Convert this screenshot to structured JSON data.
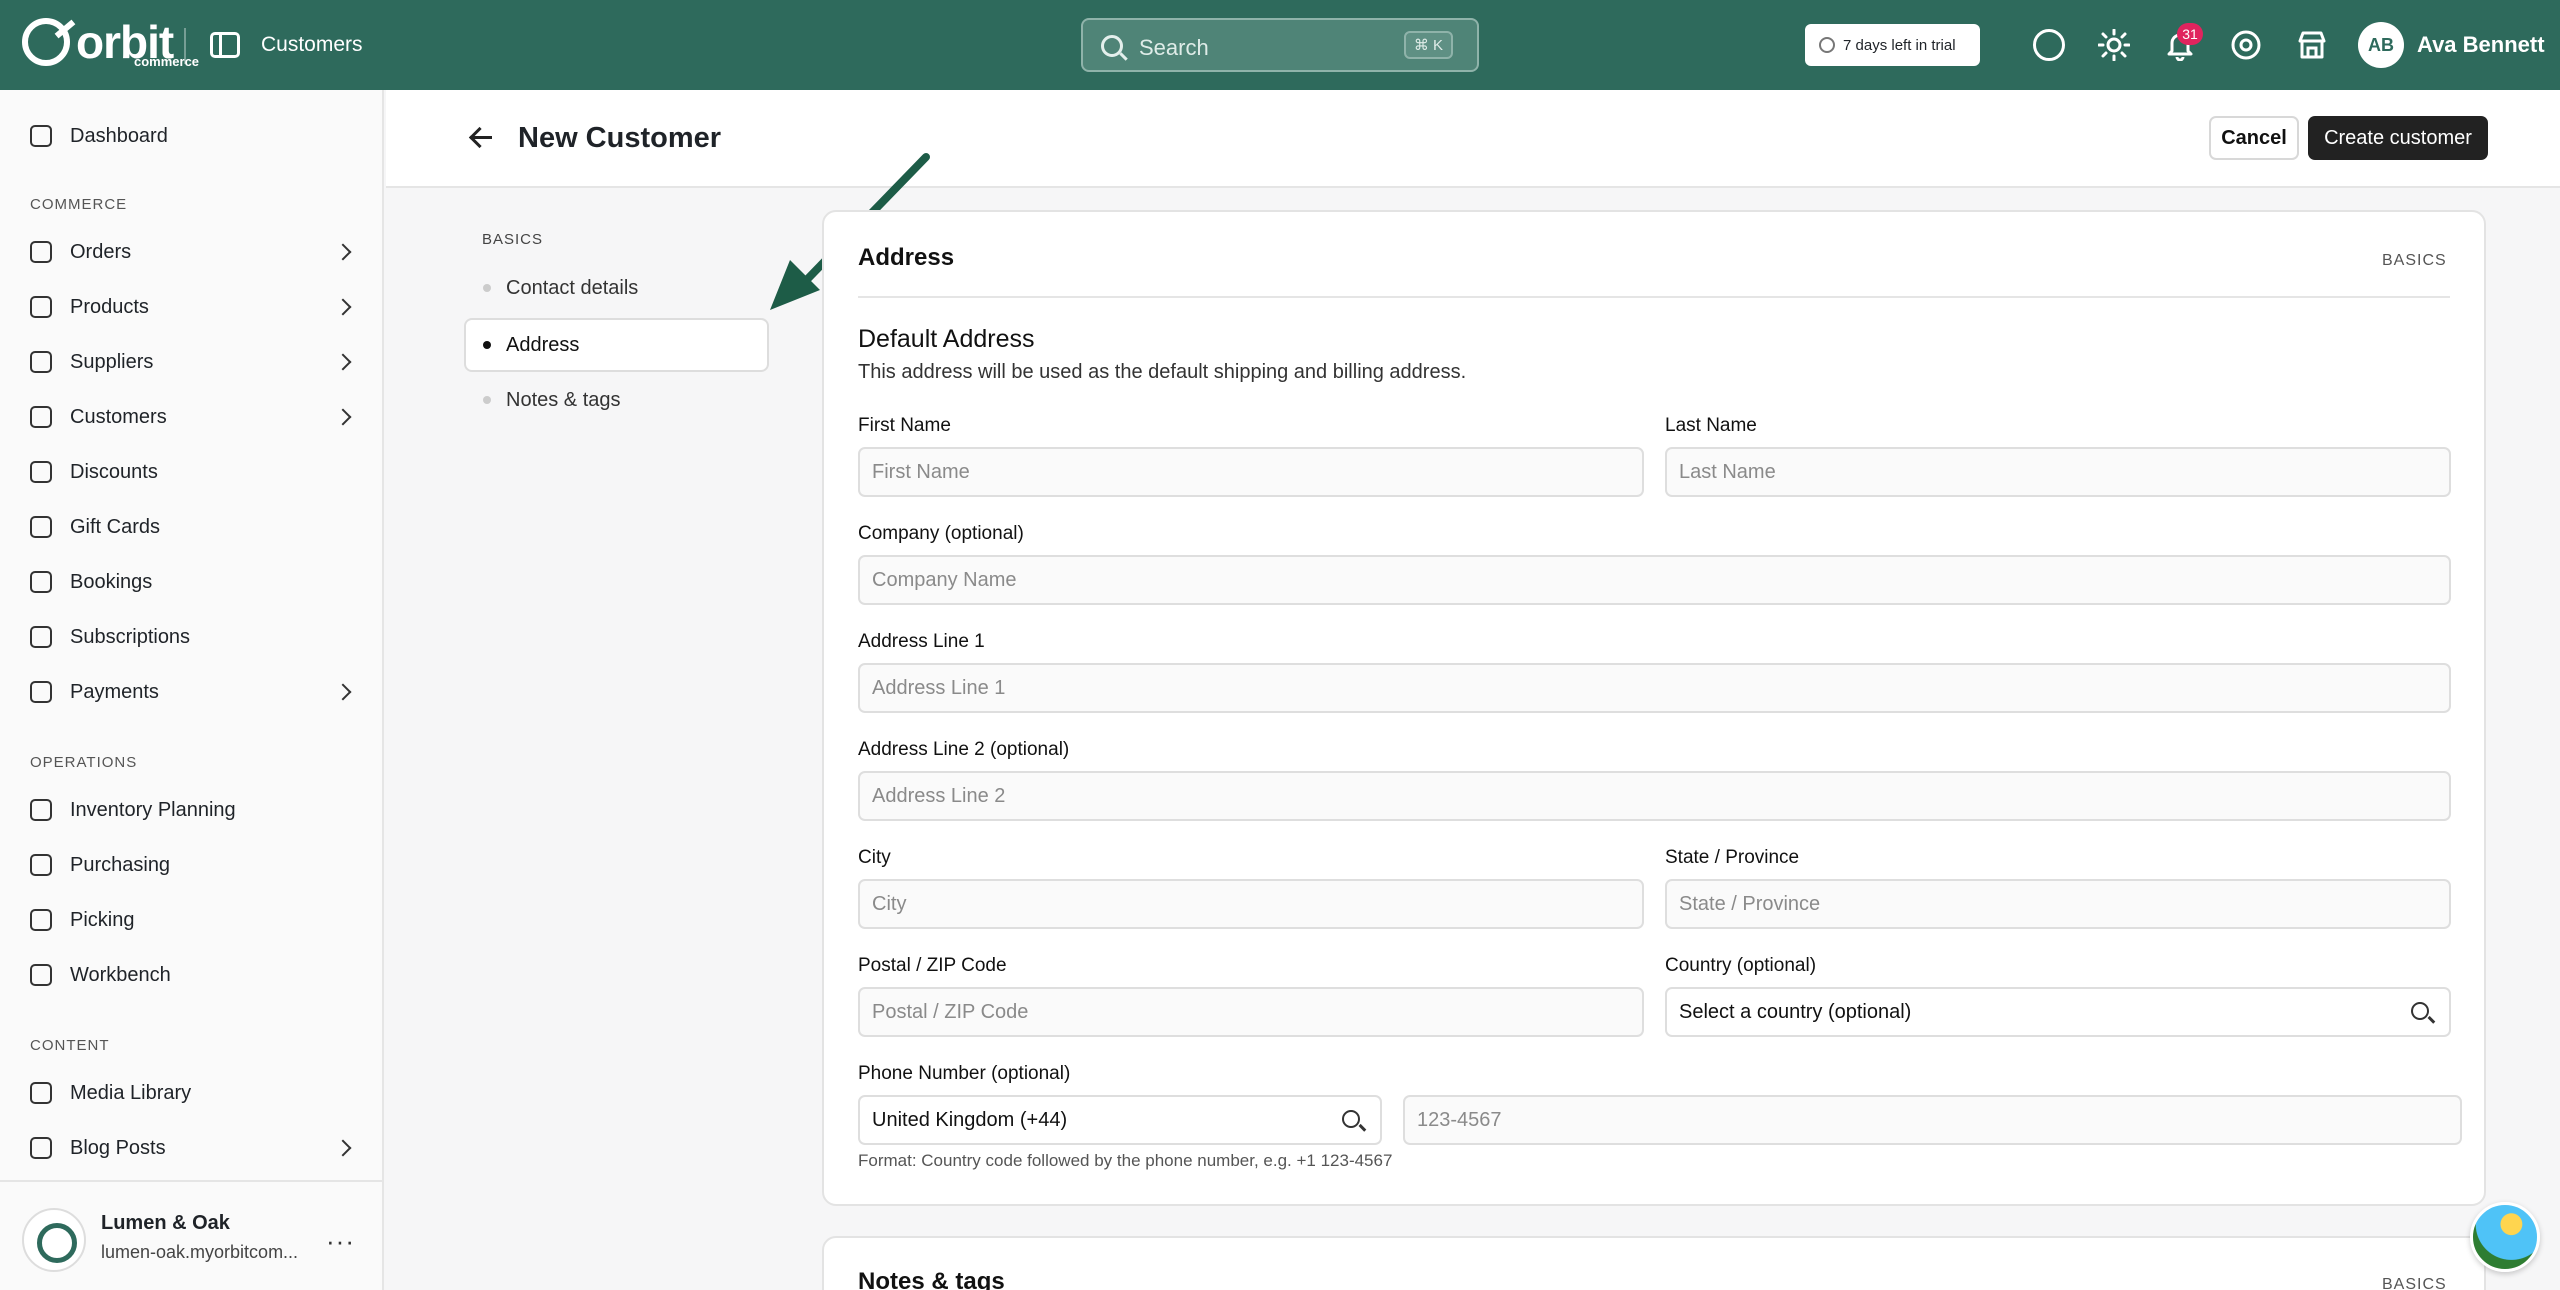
{
  "topbar": {
    "logo_word": "orbit",
    "logo_sub": "commerce",
    "page": "Customers",
    "search_placeholder": "Search",
    "search_shortcut": "⌘ K",
    "trial": "7 days left in trial",
    "notifications_count": "31",
    "avatar_initials": "AB",
    "user_name": "Ava Bennett",
    "accent": "#2e6a5c"
  },
  "sidebar": {
    "dashboard": "Dashboard",
    "commerce_heading": "COMMERCE",
    "commerce": [
      "Orders",
      "Products",
      "Suppliers",
      "Customers",
      "Discounts",
      "Gift Cards",
      "Bookings",
      "Subscriptions",
      "Payments"
    ],
    "operations_heading": "OPERATIONS",
    "operations": [
      "Inventory Planning",
      "Purchasing",
      "Picking",
      "Workbench"
    ],
    "content_heading": "CONTENT",
    "content": [
      "Media Library",
      "Blog Posts"
    ],
    "store_name": "Lumen & Oak",
    "store_url": "lumen-oak.myorbitcom..."
  },
  "header": {
    "title": "New Customer",
    "cancel": "Cancel",
    "create": "Create customer"
  },
  "toc": {
    "heading": "BASICS",
    "items": [
      "Contact details",
      "Address",
      "Notes & tags"
    ],
    "active": "Address"
  },
  "address_card": {
    "title": "Address",
    "tag": "BASICS",
    "subtitle": "Default Address",
    "description": "This address will be used as the default shipping and billing address.",
    "first_name_label": "First Name",
    "first_name_ph": "First Name",
    "last_name_label": "Last Name",
    "last_name_ph": "Last Name",
    "company_label": "Company (optional)",
    "company_ph": "Company Name",
    "line1_label": "Address Line 1",
    "line1_ph": "Address Line 1",
    "line2_label": "Address Line 2 (optional)",
    "line2_ph": "Address Line 2",
    "city_label": "City",
    "city_ph": "City",
    "state_label": "State / Province",
    "state_ph": "State / Province",
    "postal_label": "Postal / ZIP Code",
    "postal_ph": "Postal / ZIP Code",
    "country_label": "Country (optional)",
    "country_value": "Select a country (optional)",
    "phone_label": "Phone Number (optional)",
    "phone_country": "United Kingdom (+44)",
    "phone_ph": "123-4567",
    "phone_help": "Format: Country code followed by the phone number, e.g. +1 123-4567"
  },
  "notes_card": {
    "title": "Notes & tags",
    "tag": "BASICS"
  }
}
